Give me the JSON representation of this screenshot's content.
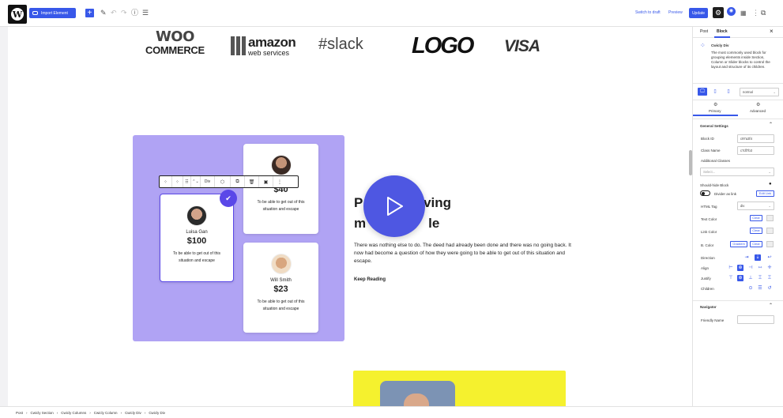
{
  "toolbar": {
    "import_label": "Import Element",
    "switch_draft": "Switch to draft",
    "preview": "Preview",
    "update": "Update"
  },
  "logos": {
    "woo_top": "WOO",
    "woo_bottom": "COMMERCE",
    "amazon_top": "amazon",
    "amazon_bottom": "web services",
    "slack": "slack",
    "logo": "LOGO",
    "visa": "VISA"
  },
  "block_toolbar": {
    "div_label": "Div"
  },
  "cards": [
    {
      "name": "",
      "price": "$40",
      "desc": "To be able to get out of this situation and escape"
    },
    {
      "name": "Luisa Gan",
      "price": "$100",
      "desc": "To be able to get out of this situation and escape"
    },
    {
      "name": "Will Smith",
      "price": "$23",
      "desc": "To be able to get out of this situation and escape"
    }
  ],
  "content": {
    "heading_l1a": "P",
    "heading_l1b": "lving",
    "heading_l2a": "m",
    "heading_l2b": "le",
    "paragraph": "There was nothing else to do. The deed had already been done and there was no going back. It now had become a question of how they were going to be able to get out of this situation and escape.",
    "link": "Keep Reading"
  },
  "sidebar": {
    "tab_post": "Post",
    "tab_block": "Block",
    "close": "×",
    "block_name": "Cwicly Div",
    "block_desc": "The most commonly used block for grouping elements inside Section, Column or Slider blocks to control the layout and structure of its children.",
    "state_select": "normal",
    "tab_primary": "Primary",
    "tab_advanced": "Advanced",
    "general_settings": "General Settings",
    "block_id_label": "Block ID",
    "block_id_value": "c97a3f4",
    "class_name_label": "Class Name",
    "class_name_value": "c7df7b3",
    "additional_classes": "Additional Classes",
    "select_placeholder": "Select...",
    "should_hide": "Should-hide Block",
    "divider_link": "Divider as link",
    "edit_link": "Edit Link",
    "html_tag_label": "HTML Tag",
    "html_tag_value": "div",
    "text_color": "Text Color",
    "link_color": "Link Color",
    "b_color": "B. Color",
    "clear": "Clear",
    "gradient": "Gradient",
    "direction": "Direction",
    "align": "Align",
    "justify": "Justify",
    "children": "Children",
    "navigator": "Navigator",
    "friendly_name": "Friendly Name"
  },
  "breadcrumb": [
    "Post",
    "Cwicly Section",
    "Cwicly Columns",
    "Cwicly Column",
    "Cwicly Div",
    "Cwicly Div"
  ],
  "colors": {
    "accent": "#3858e9",
    "purple_bg": "#b0a3f4",
    "play": "#4e57e2",
    "yellow": "#f5f12e"
  }
}
